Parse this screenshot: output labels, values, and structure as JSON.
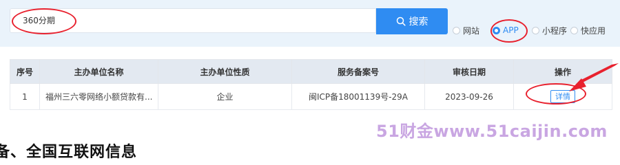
{
  "search": {
    "value": "360分期",
    "button_label": "搜索",
    "icon": "search-icon"
  },
  "filter": {
    "options": [
      {
        "label": "网站",
        "selected": false
      },
      {
        "label": "APP",
        "selected": true
      },
      {
        "label": "小程序",
        "selected": false
      },
      {
        "label": "快应用",
        "selected": false
      }
    ]
  },
  "table": {
    "headers": [
      "序号",
      "主办单位名称",
      "主办单位性质",
      "服务备案号",
      "审核日期",
      "操作"
    ],
    "rows": [
      {
        "index": "1",
        "name": "福州三六零网络小额贷款有...",
        "type": "企业",
        "icp": "闽ICP备18001139号-29A",
        "date": "2023-09-26",
        "action": "详情"
      }
    ]
  },
  "watermark": "51财金www.51caijin.com",
  "heading_partial": "备、全国互联网信息",
  "colors": {
    "accent": "#2f8cf2",
    "annotation": "#e8212e",
    "watermark": "#c9a6e2"
  }
}
